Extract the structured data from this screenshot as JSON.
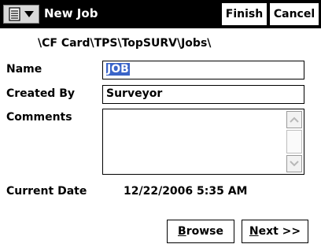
{
  "window": {
    "title": "New Job",
    "finish_label": "Finish",
    "cancel_label": "Cancel"
  },
  "path": "\\CF Card\\TPS\\TopSURV\\Jobs\\",
  "form": {
    "name_label": "Name",
    "name_value": "JOB",
    "created_by_label": "Created By",
    "created_by_value": "Surveyor",
    "comments_label": "Comments",
    "comments_value": "",
    "current_date_label": "Current Date",
    "current_date_value": "12/22/2006 5:35 AM"
  },
  "buttons": {
    "browse_first": "B",
    "browse_rest": "rowse",
    "next_first": "N",
    "next_rest": "ext >>"
  },
  "icons": {
    "menu": "start-menu-icon",
    "dropdown": "triangle-down-icon",
    "scroll_up": "scroll-up-arrow-icon",
    "scroll_down": "scroll-down-arrow-icon"
  },
  "colors": {
    "titlebar": "#000000",
    "selection": "#3a64c8"
  }
}
